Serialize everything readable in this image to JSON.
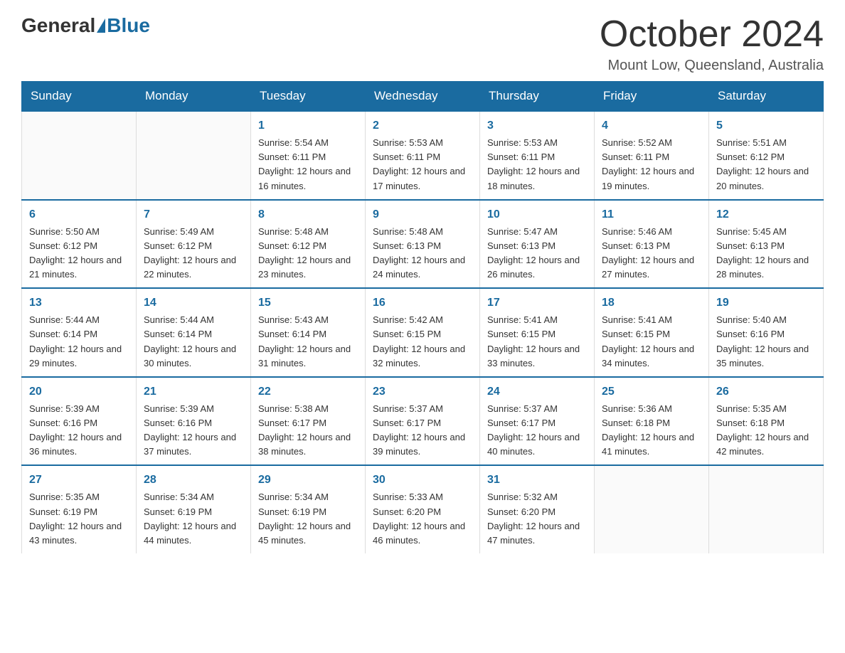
{
  "logo": {
    "general": "General",
    "blue": "Blue"
  },
  "title": "October 2024",
  "location": "Mount Low, Queensland, Australia",
  "headers": [
    "Sunday",
    "Monday",
    "Tuesday",
    "Wednesday",
    "Thursday",
    "Friday",
    "Saturday"
  ],
  "weeks": [
    [
      {
        "day": "",
        "sunrise": "",
        "sunset": "",
        "daylight": ""
      },
      {
        "day": "",
        "sunrise": "",
        "sunset": "",
        "daylight": ""
      },
      {
        "day": "1",
        "sunrise": "Sunrise: 5:54 AM",
        "sunset": "Sunset: 6:11 PM",
        "daylight": "Daylight: 12 hours and 16 minutes."
      },
      {
        "day": "2",
        "sunrise": "Sunrise: 5:53 AM",
        "sunset": "Sunset: 6:11 PM",
        "daylight": "Daylight: 12 hours and 17 minutes."
      },
      {
        "day": "3",
        "sunrise": "Sunrise: 5:53 AM",
        "sunset": "Sunset: 6:11 PM",
        "daylight": "Daylight: 12 hours and 18 minutes."
      },
      {
        "day": "4",
        "sunrise": "Sunrise: 5:52 AM",
        "sunset": "Sunset: 6:11 PM",
        "daylight": "Daylight: 12 hours and 19 minutes."
      },
      {
        "day": "5",
        "sunrise": "Sunrise: 5:51 AM",
        "sunset": "Sunset: 6:12 PM",
        "daylight": "Daylight: 12 hours and 20 minutes."
      }
    ],
    [
      {
        "day": "6",
        "sunrise": "Sunrise: 5:50 AM",
        "sunset": "Sunset: 6:12 PM",
        "daylight": "Daylight: 12 hours and 21 minutes."
      },
      {
        "day": "7",
        "sunrise": "Sunrise: 5:49 AM",
        "sunset": "Sunset: 6:12 PM",
        "daylight": "Daylight: 12 hours and 22 minutes."
      },
      {
        "day": "8",
        "sunrise": "Sunrise: 5:48 AM",
        "sunset": "Sunset: 6:12 PM",
        "daylight": "Daylight: 12 hours and 23 minutes."
      },
      {
        "day": "9",
        "sunrise": "Sunrise: 5:48 AM",
        "sunset": "Sunset: 6:13 PM",
        "daylight": "Daylight: 12 hours and 24 minutes."
      },
      {
        "day": "10",
        "sunrise": "Sunrise: 5:47 AM",
        "sunset": "Sunset: 6:13 PM",
        "daylight": "Daylight: 12 hours and 26 minutes."
      },
      {
        "day": "11",
        "sunrise": "Sunrise: 5:46 AM",
        "sunset": "Sunset: 6:13 PM",
        "daylight": "Daylight: 12 hours and 27 minutes."
      },
      {
        "day": "12",
        "sunrise": "Sunrise: 5:45 AM",
        "sunset": "Sunset: 6:13 PM",
        "daylight": "Daylight: 12 hours and 28 minutes."
      }
    ],
    [
      {
        "day": "13",
        "sunrise": "Sunrise: 5:44 AM",
        "sunset": "Sunset: 6:14 PM",
        "daylight": "Daylight: 12 hours and 29 minutes."
      },
      {
        "day": "14",
        "sunrise": "Sunrise: 5:44 AM",
        "sunset": "Sunset: 6:14 PM",
        "daylight": "Daylight: 12 hours and 30 minutes."
      },
      {
        "day": "15",
        "sunrise": "Sunrise: 5:43 AM",
        "sunset": "Sunset: 6:14 PM",
        "daylight": "Daylight: 12 hours and 31 minutes."
      },
      {
        "day": "16",
        "sunrise": "Sunrise: 5:42 AM",
        "sunset": "Sunset: 6:15 PM",
        "daylight": "Daylight: 12 hours and 32 minutes."
      },
      {
        "day": "17",
        "sunrise": "Sunrise: 5:41 AM",
        "sunset": "Sunset: 6:15 PM",
        "daylight": "Daylight: 12 hours and 33 minutes."
      },
      {
        "day": "18",
        "sunrise": "Sunrise: 5:41 AM",
        "sunset": "Sunset: 6:15 PM",
        "daylight": "Daylight: 12 hours and 34 minutes."
      },
      {
        "day": "19",
        "sunrise": "Sunrise: 5:40 AM",
        "sunset": "Sunset: 6:16 PM",
        "daylight": "Daylight: 12 hours and 35 minutes."
      }
    ],
    [
      {
        "day": "20",
        "sunrise": "Sunrise: 5:39 AM",
        "sunset": "Sunset: 6:16 PM",
        "daylight": "Daylight: 12 hours and 36 minutes."
      },
      {
        "day": "21",
        "sunrise": "Sunrise: 5:39 AM",
        "sunset": "Sunset: 6:16 PM",
        "daylight": "Daylight: 12 hours and 37 minutes."
      },
      {
        "day": "22",
        "sunrise": "Sunrise: 5:38 AM",
        "sunset": "Sunset: 6:17 PM",
        "daylight": "Daylight: 12 hours and 38 minutes."
      },
      {
        "day": "23",
        "sunrise": "Sunrise: 5:37 AM",
        "sunset": "Sunset: 6:17 PM",
        "daylight": "Daylight: 12 hours and 39 minutes."
      },
      {
        "day": "24",
        "sunrise": "Sunrise: 5:37 AM",
        "sunset": "Sunset: 6:17 PM",
        "daylight": "Daylight: 12 hours and 40 minutes."
      },
      {
        "day": "25",
        "sunrise": "Sunrise: 5:36 AM",
        "sunset": "Sunset: 6:18 PM",
        "daylight": "Daylight: 12 hours and 41 minutes."
      },
      {
        "day": "26",
        "sunrise": "Sunrise: 5:35 AM",
        "sunset": "Sunset: 6:18 PM",
        "daylight": "Daylight: 12 hours and 42 minutes."
      }
    ],
    [
      {
        "day": "27",
        "sunrise": "Sunrise: 5:35 AM",
        "sunset": "Sunset: 6:19 PM",
        "daylight": "Daylight: 12 hours and 43 minutes."
      },
      {
        "day": "28",
        "sunrise": "Sunrise: 5:34 AM",
        "sunset": "Sunset: 6:19 PM",
        "daylight": "Daylight: 12 hours and 44 minutes."
      },
      {
        "day": "29",
        "sunrise": "Sunrise: 5:34 AM",
        "sunset": "Sunset: 6:19 PM",
        "daylight": "Daylight: 12 hours and 45 minutes."
      },
      {
        "day": "30",
        "sunrise": "Sunrise: 5:33 AM",
        "sunset": "Sunset: 6:20 PM",
        "daylight": "Daylight: 12 hours and 46 minutes."
      },
      {
        "day": "31",
        "sunrise": "Sunrise: 5:32 AM",
        "sunset": "Sunset: 6:20 PM",
        "daylight": "Daylight: 12 hours and 47 minutes."
      },
      {
        "day": "",
        "sunrise": "",
        "sunset": "",
        "daylight": ""
      },
      {
        "day": "",
        "sunrise": "",
        "sunset": "",
        "daylight": ""
      }
    ]
  ]
}
